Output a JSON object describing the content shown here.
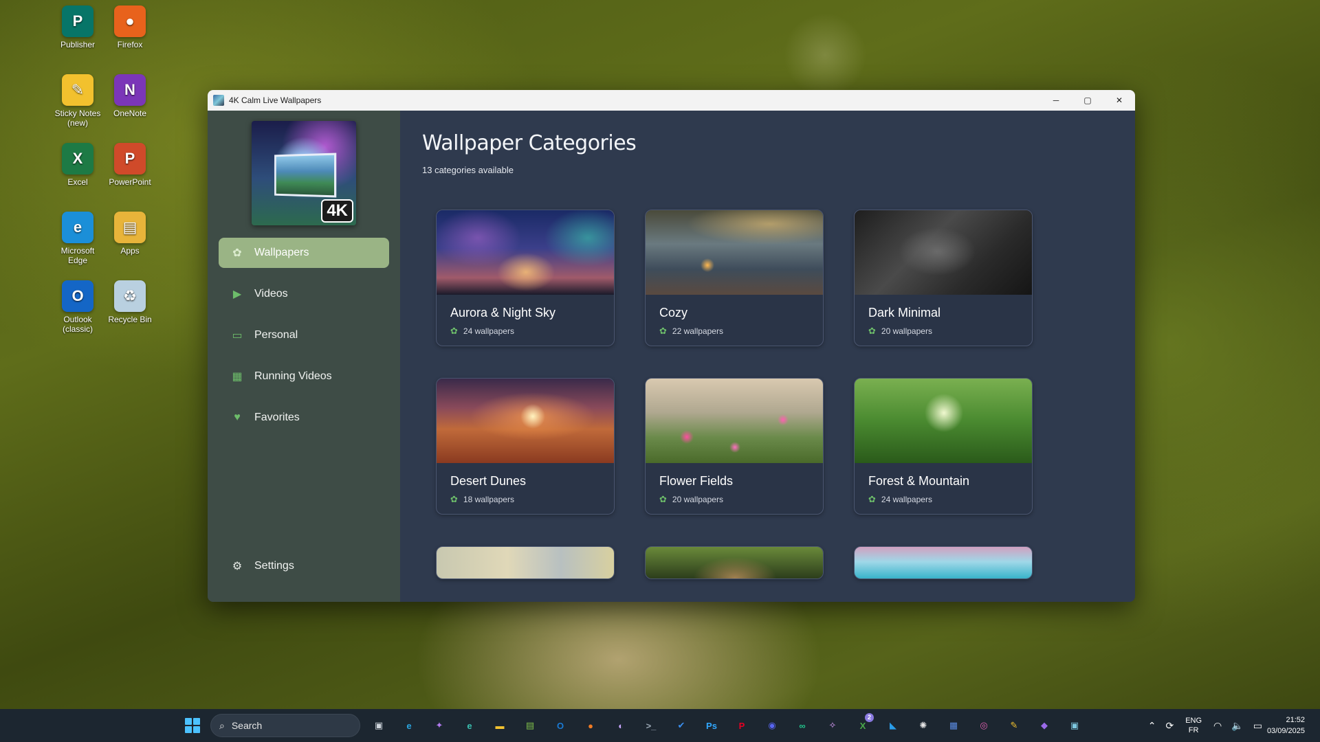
{
  "desktop": {
    "icons": [
      {
        "label": "Publisher",
        "glyph": "P",
        "color": "#077568"
      },
      {
        "label": "Firefox",
        "glyph": "●",
        "color": "#e8621c"
      },
      {
        "label": "Sticky Notes (new)",
        "glyph": "✎",
        "color": "#f2c12e"
      },
      {
        "label": "OneNote",
        "glyph": "N",
        "color": "#7b36b8"
      },
      {
        "label": "Excel",
        "glyph": "X",
        "color": "#1d7a45"
      },
      {
        "label": "PowerPoint",
        "glyph": "P",
        "color": "#d04a2a"
      },
      {
        "label": "Microsoft Edge",
        "glyph": "e",
        "color": "#1b8fd8"
      },
      {
        "label": "Apps",
        "glyph": "▤",
        "color": "#e8b43a"
      },
      {
        "label": "Outlook (classic)",
        "glyph": "O",
        "color": "#1466c6"
      },
      {
        "label": "Recycle Bin",
        "glyph": "♻",
        "color": "#b9d0e0"
      }
    ]
  },
  "window": {
    "title": "4K Calm Live Wallpapers",
    "logo_badge": "4K",
    "minimize_glyph": "─",
    "maximize_glyph": "▢",
    "close_glyph": "✕"
  },
  "sidebar": {
    "items": [
      {
        "label": "Wallpapers",
        "icon": "gallery-icon",
        "glyph": "✿",
        "active": true
      },
      {
        "label": "Videos",
        "icon": "play-icon",
        "glyph": "▶",
        "active": false
      },
      {
        "label": "Personal",
        "icon": "folder-icon",
        "glyph": "▭",
        "active": false
      },
      {
        "label": "Running Videos",
        "icon": "grid-icon",
        "glyph": "▦",
        "active": false
      },
      {
        "label": "Favorites",
        "icon": "heart-icon",
        "glyph": "♥",
        "active": false
      }
    ],
    "settings_label": "Settings",
    "settings_glyph": "⚙"
  },
  "main": {
    "title": "Wallpaper Categories",
    "subtitle": "13 categories available",
    "count_glyph": "✿",
    "categories": [
      {
        "name": "Aurora & Night Sky",
        "count": "24 wallpapers",
        "thumb": "t-aurora"
      },
      {
        "name": "Cozy",
        "count": "22 wallpapers",
        "thumb": "t-cozy"
      },
      {
        "name": "Dark Minimal",
        "count": "20 wallpapers",
        "thumb": "t-dark"
      },
      {
        "name": "Desert Dunes",
        "count": "18 wallpapers",
        "thumb": "t-desert"
      },
      {
        "name": "Flower Fields",
        "count": "20 wallpapers",
        "thumb": "t-flower"
      },
      {
        "name": "Forest & Mountain",
        "count": "24 wallpapers",
        "thumb": "t-forest"
      }
    ],
    "partial_thumbs": [
      "t-abstract",
      "t-owl",
      "t-sea"
    ]
  },
  "taskbar": {
    "search_placeholder": "Search",
    "apps": [
      {
        "name": "task-view",
        "glyph": "▣",
        "color": "#cfd6dc"
      },
      {
        "name": "edge",
        "glyph": "e",
        "color": "#2aa6e0"
      },
      {
        "name": "copilot",
        "glyph": "✦",
        "color": "#b37bf0"
      },
      {
        "name": "edge-dev",
        "glyph": "e",
        "color": "#3ac0b0"
      },
      {
        "name": "file-explorer",
        "glyph": "▬",
        "color": "#f2c230"
      },
      {
        "name": "notepad",
        "glyph": "▤",
        "color": "#7fbf4a"
      },
      {
        "name": "outlook",
        "glyph": "O",
        "color": "#1a7ad4"
      },
      {
        "name": "firefox",
        "glyph": "●",
        "color": "#f07b24"
      },
      {
        "name": "app-purple",
        "glyph": "◐",
        "color": "#c9a6ff"
      },
      {
        "name": "terminal",
        "glyph": ">_",
        "color": "#9aa7b4"
      },
      {
        "name": "todo",
        "glyph": "✔",
        "color": "#3a8ff0"
      },
      {
        "name": "photoshop",
        "glyph": "Ps",
        "color": "#31a8ff"
      },
      {
        "name": "pinterest",
        "glyph": "P",
        "color": "#e60023"
      },
      {
        "name": "discord",
        "glyph": "◉",
        "color": "#5865f2"
      },
      {
        "name": "app-green",
        "glyph": "∞",
        "color": "#23c48c"
      },
      {
        "name": "app-wand",
        "glyph": "✧",
        "color": "#e0a0ff"
      },
      {
        "name": "xbox",
        "glyph": "X",
        "color": "#4aa84a"
      },
      {
        "name": "vscode",
        "glyph": "◣",
        "color": "#2a9ce8"
      },
      {
        "name": "chatgpt",
        "glyph": "✺",
        "color": "#e6e6e6"
      },
      {
        "name": "app-blue",
        "glyph": "▦",
        "color": "#5a8ae0"
      },
      {
        "name": "app-pink",
        "glyph": "◎",
        "color": "#e060b0"
      },
      {
        "name": "sticky-notes",
        "glyph": "✎",
        "color": "#f2c12e"
      },
      {
        "name": "visual-studio",
        "glyph": "◆",
        "color": "#9a6ae8"
      },
      {
        "name": "calm-wallpapers",
        "glyph": "▣",
        "color": "#7ec8e0"
      }
    ],
    "xbox_badge": "2",
    "tray_chevron": "⌃",
    "tray_sync": "⟳",
    "lang_top": "ENG",
    "lang_bottom": "FR",
    "wifi_glyph": "◠",
    "volume_glyph": "🔈",
    "battery_glyph": "▭",
    "time": "21:52",
    "date": "03/09/2025"
  }
}
